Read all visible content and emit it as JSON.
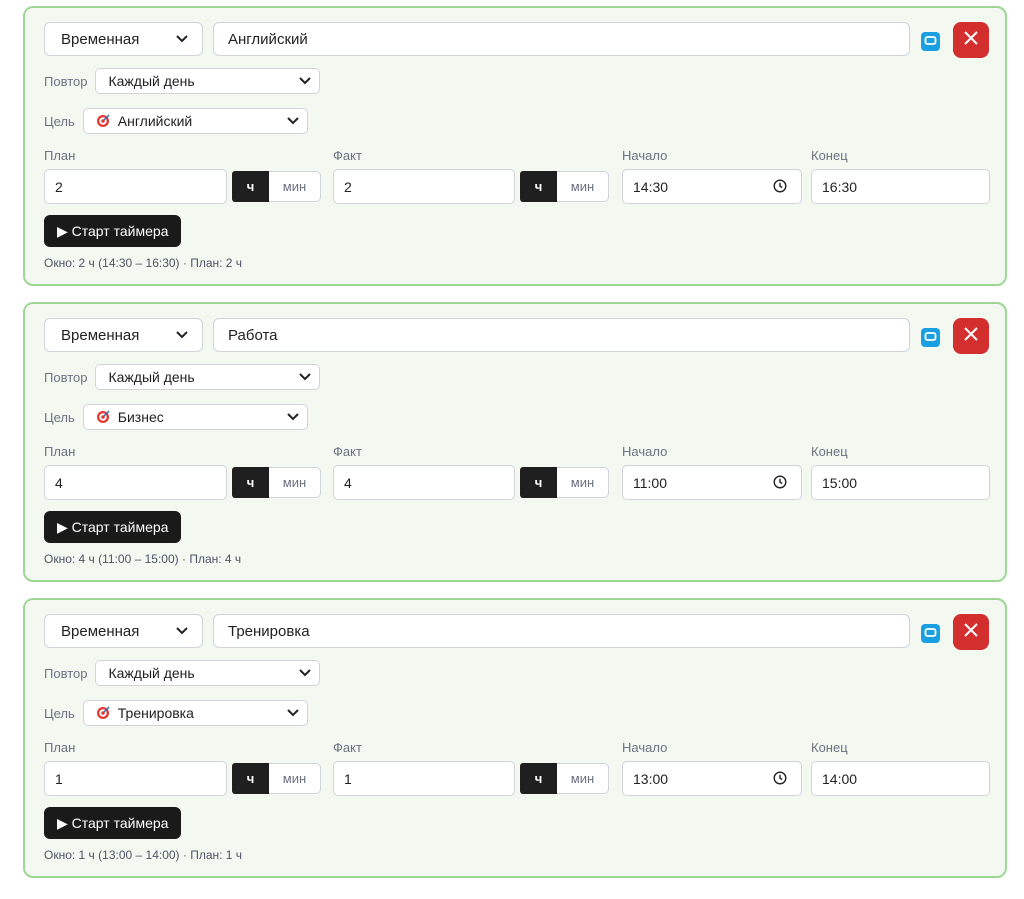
{
  "cards": [
    {
      "type": "Временная",
      "title": "Английский",
      "repeat_label": "Повтор",
      "repeat": "Каждый день",
      "goal_label": "Цель",
      "goal": "Английский",
      "plan_label": "План",
      "plan": "2",
      "fact_label": "Факт",
      "fact": "2",
      "unit_h": "ч",
      "unit_m": "мин",
      "start_label": "Начало",
      "start": "14:30",
      "end_label": "Конец",
      "end": "16:30",
      "timer_button": "▶ Старт таймера",
      "summary": "Окно: 2 ч (14:30 – 16:30) · План: 2 ч"
    },
    {
      "type": "Временная",
      "title": "Работа",
      "repeat_label": "Повтор",
      "repeat": "Каждый день",
      "goal_label": "Цель",
      "goal": "Бизнес",
      "plan_label": "План",
      "plan": "4",
      "fact_label": "Факт",
      "fact": "4",
      "unit_h": "ч",
      "unit_m": "мин",
      "start_label": "Начало",
      "start": "11:00",
      "end_label": "Конец",
      "end": "15:00",
      "timer_button": "▶ Старт таймера",
      "summary": "Окно: 4 ч (11:00 – 15:00) · План: 4 ч"
    },
    {
      "type": "Временная",
      "title": "Тренировка",
      "repeat_label": "Повтор",
      "repeat": "Каждый день",
      "goal_label": "Цель",
      "goal": "Тренировка",
      "plan_label": "План",
      "plan": "1",
      "fact_label": "Факт",
      "fact": "1",
      "unit_h": "ч",
      "unit_m": "мин",
      "start_label": "Начало",
      "start": "13:00",
      "end_label": "Конец",
      "end": "14:00",
      "timer_button": "▶ Старт таймера",
      "summary": "Окно: 1 ч (13:00 – 14:00) · План: 1 ч"
    }
  ],
  "colors": {
    "card_bg": "#f3f8f1",
    "card_border": "#9fd696",
    "repeat_icon": "#1aa0e0",
    "delete": "#d32f2f",
    "dark_button": "#1a1a1a"
  },
  "icons": {
    "dropdown": "chevron-down-icon",
    "repeat": "repeat-icon",
    "delete": "close-icon",
    "goal": "target-icon",
    "time": "clock-icon"
  }
}
